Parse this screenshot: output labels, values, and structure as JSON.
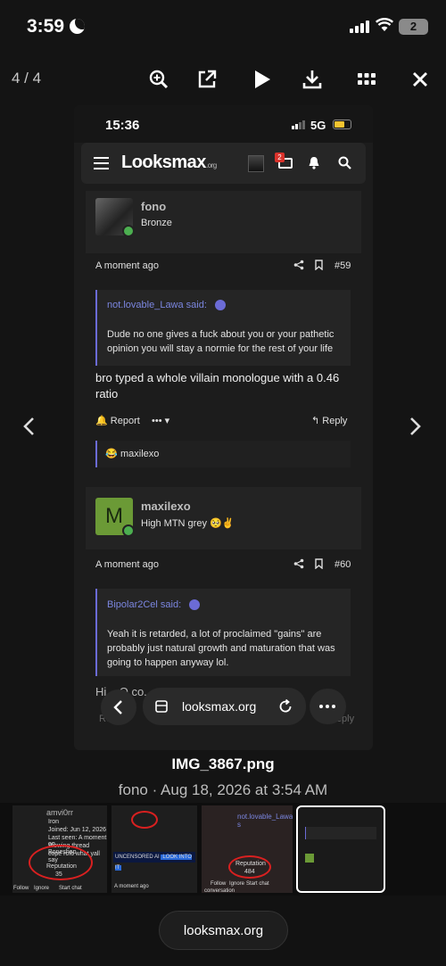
{
  "status": {
    "time": "3:59",
    "battery": "2"
  },
  "viewer": {
    "counter": "4 / 4",
    "filename": "IMG_3867.png",
    "subtitle": "fono · Aug 18, 2026 at 3:54 AM"
  },
  "inner": {
    "time": "15:36",
    "network": "5G",
    "site": {
      "logo": "Looksmax",
      "logo_suffix": ".org",
      "notif_count": "2"
    },
    "post1": {
      "username": "fono",
      "title": "Bronze",
      "time": "A moment ago",
      "number": "#59",
      "quote_author": "not.lovable_Lawa said:",
      "quote_text": "Dude no one gives a fuck about you or your pathetic opinion you will stay a normie for the rest of your life",
      "body": "bro typed a whole villain monologue with a 0.46 ratio",
      "report": "Report",
      "more": "•••",
      "reply": "Reply",
      "reaction_user": "maxilexo",
      "reaction_emoji": "😂"
    },
    "post2": {
      "username": "maxilexo",
      "avatar_letter": "M",
      "title": "High MTN grey 🥺✌️",
      "time": "A moment ago",
      "number": "#60",
      "quote_author": "Bipolar2Cel said:",
      "quote_text": "Yeah it is retarded, a lot of proclaimed \"gains\" are probably just natural growth and maturation that was going to happen anyway lol.",
      "body_partial": "Hi ...O co...",
      "report": "Report",
      "reply": "Reply"
    },
    "browser": {
      "url": "looksmax.org"
    }
  },
  "thumbs": {
    "t1": {
      "username": "amvi0rr",
      "title": "Iron",
      "joined": "Joined: Jun 12, 2026",
      "last_seen": "Last seen: A moment ag",
      "viewing": "Viewing thread Boneshap",
      "cope": "cope rofc what yall say",
      "rep_label": "Reputation",
      "rep_value": "35",
      "follow": "Follow",
      "ignore": "Ignore",
      "chat": "Start chat"
    },
    "t2": {
      "label": "UNCENSORED AI",
      "cta": "LOOK INTO IT",
      "time": "A moment ago"
    },
    "t3": {
      "quote": "not.lovable_Lawa s",
      "rep_label": "Reputation",
      "rep_value": "484",
      "follow": "Follow",
      "ignore": "Ignore",
      "chat": "Start chat",
      "conv": "conversation"
    }
  },
  "bottom": {
    "url": "looksmax.org"
  }
}
